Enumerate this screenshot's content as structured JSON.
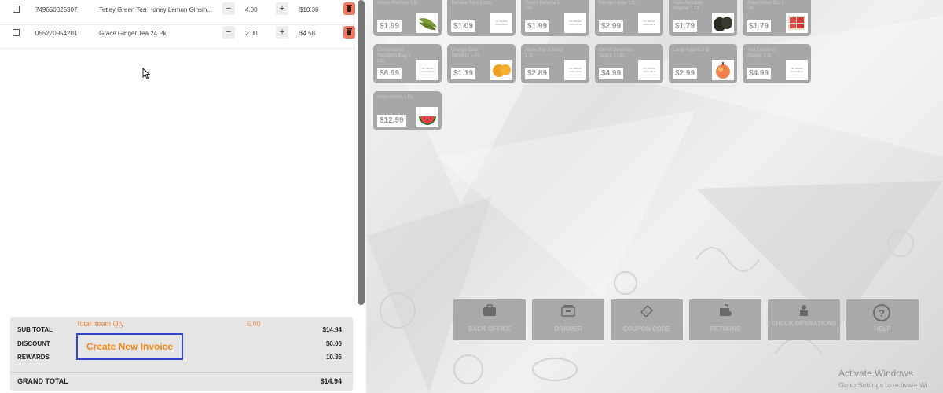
{
  "cart": {
    "items": [
      {
        "code": "749650025307",
        "name": "Tetley Green Tea Honey Lemon Ginsin...",
        "qty": "4.00",
        "price": "$10.36"
      },
      {
        "code": "055270954201",
        "name": "Grace Ginger Tea 24 Pk",
        "qty": "2.00",
        "price": "$4.58"
      }
    ],
    "minus_label": "−",
    "plus_label": "+"
  },
  "totals": {
    "total_item_qty_label": "Total Iteam Qty",
    "total_item_qty_value": "6.00",
    "subtotal_label": "SUB TOTAL",
    "subtotal_value": "$14.94",
    "discount_label": "DISCOUNT",
    "discount_value": "$0.00",
    "rewards_label": "REWARDS",
    "rewards_value": "10.36",
    "grand_total_label": "GRAND TOTAL",
    "grand_total_value": "$14.94",
    "create_invoice_label": "Create New Invoice"
  },
  "products": [
    {
      "name": "Green Plantain 1 lb",
      "price": "$1.99",
      "image": "green-plantain-image"
    },
    {
      "name": "Banana Ripe 1 Lbs",
      "price": "$1.09",
      "image": "no-image"
    },
    {
      "name": "Green Banana 1 Lbs",
      "price": "$1.99",
      "image": "no-image"
    },
    {
      "name": "Mango Large 1 lb",
      "price": "$2.99",
      "image": "no-image"
    },
    {
      "name": "Hass Avocado Regular 1 Ct",
      "price": "$1.79",
      "image": "avocado-image"
    },
    {
      "name": "Watermelon Cut 1 Lbs",
      "price": "$1.79",
      "image": "watermelon-cut-image"
    },
    {
      "name": "Clementines Mandarin Bag 3 Lbs",
      "price": "$8.99",
      "image": "no-image"
    },
    {
      "name": "Orange Cara Valencia 1 Pc",
      "price": "$1.19",
      "image": "orange-image"
    },
    {
      "name": "Apple Fuji X-fancy 1 lb",
      "price": "$2.89",
      "image": "no-image"
    },
    {
      "name": "Green Seedless Grape 1 Lbs",
      "price": "$4.99",
      "image": "no-image"
    },
    {
      "name": "Large Apples 1 lb",
      "price": "$2.99",
      "image": "apple-image"
    },
    {
      "name": "Red Seedless Grapes 1 lb",
      "price": "$4.99",
      "image": "no-image"
    },
    {
      "name": "Watermelon 1 Pc",
      "price": "$12.99",
      "image": "watermelon-image"
    }
  ],
  "no_image_text": "NO IMAGE AVAILABLE",
  "function_buttons": [
    {
      "label": "BACK OFFICE",
      "icon": "briefcase-icon"
    },
    {
      "label": "DRAWER",
      "icon": "drawer-icon"
    },
    {
      "label": "COUPON CODE",
      "icon": "ticket-icon"
    },
    {
      "label": "RETURNS",
      "icon": "returns-icon"
    },
    {
      "label": "CHECK OPERATIONS",
      "icon": "operator-icon"
    },
    {
      "label": "HELP",
      "icon": "help-icon"
    }
  ],
  "watermark": {
    "title": "Activate Windows",
    "subtitle": "Go to Settings to activate Wi"
  },
  "colors": {
    "accent_orange": "#f08a1c",
    "delete_red": "#ef7a5e",
    "tile_gray": "#a7a7a7",
    "highlight_blue": "#3344cc"
  }
}
